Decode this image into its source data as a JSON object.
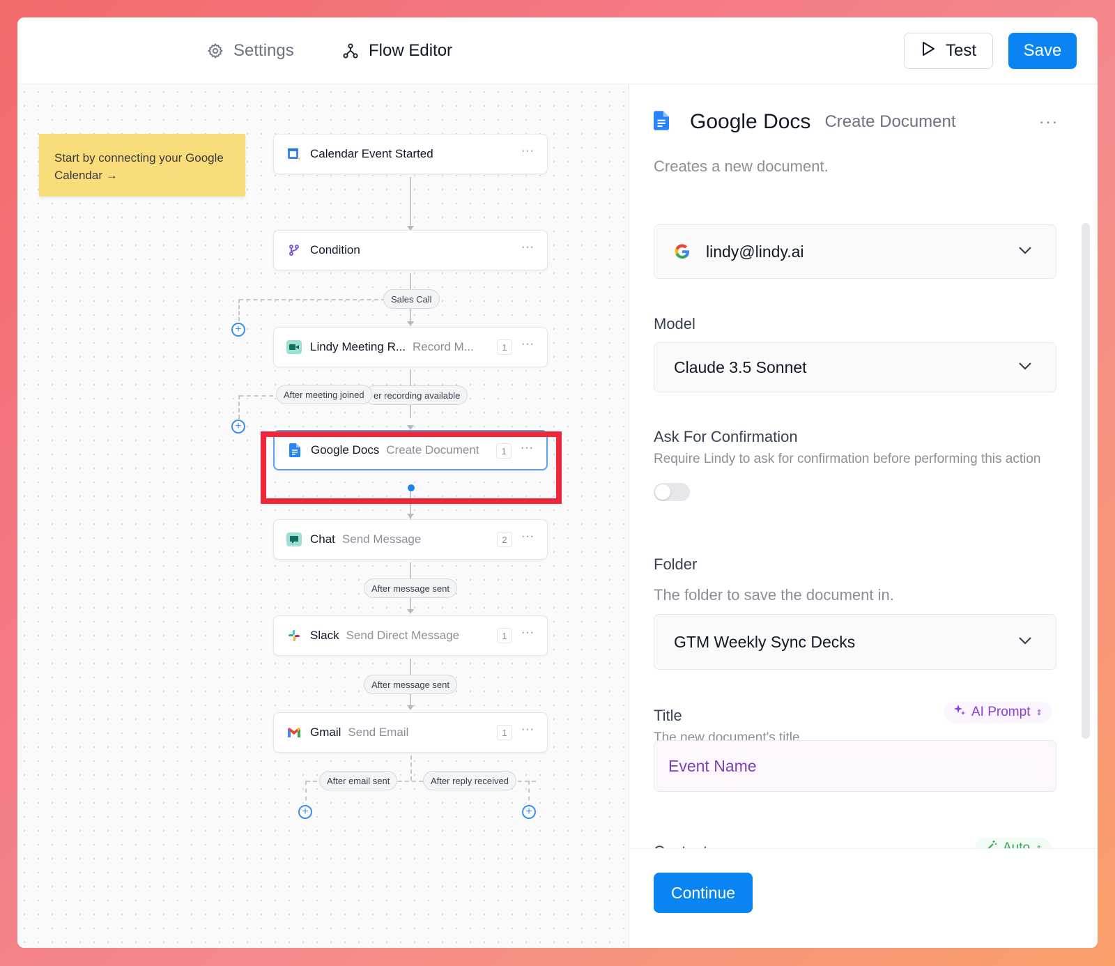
{
  "header": {
    "tabs": [
      {
        "label": "Settings",
        "icon": "gear-icon"
      },
      {
        "label": "Flow Editor",
        "icon": "flow-icon"
      }
    ],
    "test_label": "Test",
    "save_label": "Save"
  },
  "canvas": {
    "note": "Start by connecting your Google Calendar →",
    "nodes": [
      {
        "name": "Calendar Event Started",
        "action": "",
        "count": "",
        "icon": "calendar-icon"
      },
      {
        "name": "Condition",
        "action": "",
        "count": "",
        "icon": "condition-icon"
      },
      {
        "name": "Lindy Meeting R...",
        "action": "Record M...",
        "count": "1",
        "icon": "meeting-recorder-icon"
      },
      {
        "name": "Google Docs",
        "action": "Create Document",
        "count": "1",
        "icon": "google-docs-icon"
      },
      {
        "name": "Chat",
        "action": "Send Message",
        "count": "2",
        "icon": "chat-icon"
      },
      {
        "name": "Slack",
        "action": "Send Direct Message",
        "count": "1",
        "icon": "slack-icon"
      },
      {
        "name": "Gmail",
        "action": "Send Email",
        "count": "1",
        "icon": "gmail-icon"
      }
    ],
    "pills": {
      "sales_call": "Sales Call",
      "after_meeting_joined": "After meeting joined",
      "after_recording": "er recording available",
      "after_message_sent_1": "After message sent",
      "after_message_sent_2": "After message sent",
      "after_email_sent": "After email sent",
      "after_reply_received": "After reply received"
    },
    "more_glyph": "···",
    "plus_glyph": "+"
  },
  "panel": {
    "title": "Google Docs",
    "subtitle": "Create Document",
    "description": "Creates a new document.",
    "account": "lindy@lindy.ai",
    "model_label": "Model",
    "model_value": "Claude 3.5 Sonnet",
    "confirm_label": "Ask For Confirmation",
    "confirm_help": "Require Lindy to ask for confirmation before performing this action",
    "confirm_enabled": false,
    "folder_label": "Folder",
    "folder_help": "The folder to save the document in.",
    "folder_value": "GTM Weekly Sync Decks",
    "title_label": "Title",
    "title_help": "The new document's title.",
    "title_mode": "AI Prompt",
    "title_value": "Event Name",
    "content_label": "Content",
    "content_mode": "Auto",
    "continue_label": "Continue",
    "more_glyph": "···"
  },
  "colors": {
    "accent": "#0b84f3",
    "highlight": "#f0263b",
    "note_bg": "#fadd7b",
    "ai_purple": "#8b3fd9",
    "auto_green": "#34a853"
  }
}
